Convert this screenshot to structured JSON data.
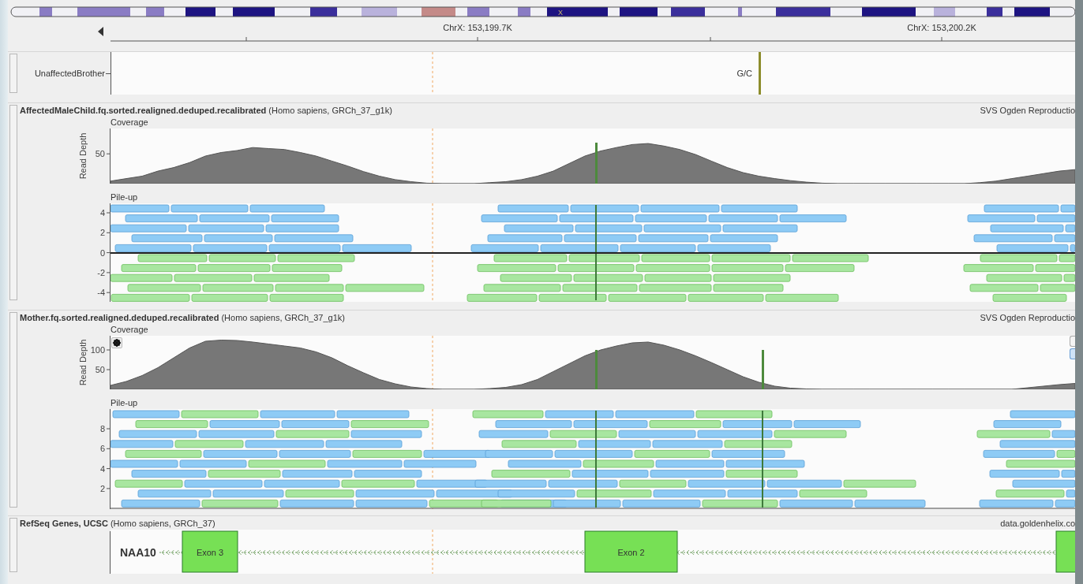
{
  "ideogram": {
    "label": "X"
  },
  "ruler": {
    "labels": [
      "ChrX: 153,199.7K",
      "ChrX: 153,200.2K"
    ]
  },
  "tracks": [
    {
      "kind": "variants",
      "name": "UnaffectedBrother",
      "variant_label": "G/C"
    },
    {
      "kind": "alignment",
      "name": "AffectedMaleChild.fq.sorted.realigned.deduped.recalibrated",
      "detail": "(Homo sapiens, GRCh_37_g1k)",
      "source": "SVS Ogden Reproductio",
      "coverage": {
        "title": "Coverage",
        "ylabel": "Read Depth",
        "yticks": [
          "50"
        ]
      },
      "pileup": {
        "title": "Pile-up",
        "yticks": [
          "4",
          "2",
          "0",
          "-2",
          "-4"
        ]
      }
    },
    {
      "kind": "alignment",
      "name": "Mother.fq.sorted.realigned.deduped.recalibrated",
      "detail": "(Homo sapiens, GRCh_37_g1k)",
      "source": "SVS Ogden Reproductio",
      "controls_visible": true,
      "coverage": {
        "chart_data": {
          "type": "area",
          "title": "Coverage",
          "ylabel": "Read Depth",
          "ylim": [
            0,
            136
          ],
          "yticks": [
            50,
            100
          ],
          "series": [
            {
              "color": "#777777",
              "values": [
                10,
                20,
                35,
                55,
                80,
                105,
                122,
                125,
                124,
                120,
                115,
                110,
                105,
                95,
                80,
                60,
                42,
                25,
                14,
                6,
                2,
                0,
                0,
                0,
                2,
                5,
                12,
                25,
                45,
                65,
                85,
                100,
                110,
                118,
                120,
                112,
                100,
                85,
                68,
                50,
                32,
                18,
                8,
                3,
                1,
                0,
                0,
                0,
                0,
                0,
                0,
                0,
                0,
                0,
                0,
                0,
                0,
                0,
                4,
                8,
                12,
                15
              ]
            }
          ]
        }
      },
      "pileup": {
        "title": "Pile-up",
        "yticks": [
          "8",
          "6",
          "4",
          "2"
        ]
      }
    },
    {
      "kind": "genes",
      "name": "RefSeq Genes, UCSC",
      "detail": "(Homo sapiens, GRCh_37)",
      "source": "data.goldenhelix.co",
      "gene": "NAA10",
      "exons": [
        {
          "kind": "labeled",
          "label": "Exon 3"
        },
        {
          "kind": "labeled",
          "label": "Exon 2"
        },
        {
          "kind": "plain"
        }
      ]
    }
  ]
}
